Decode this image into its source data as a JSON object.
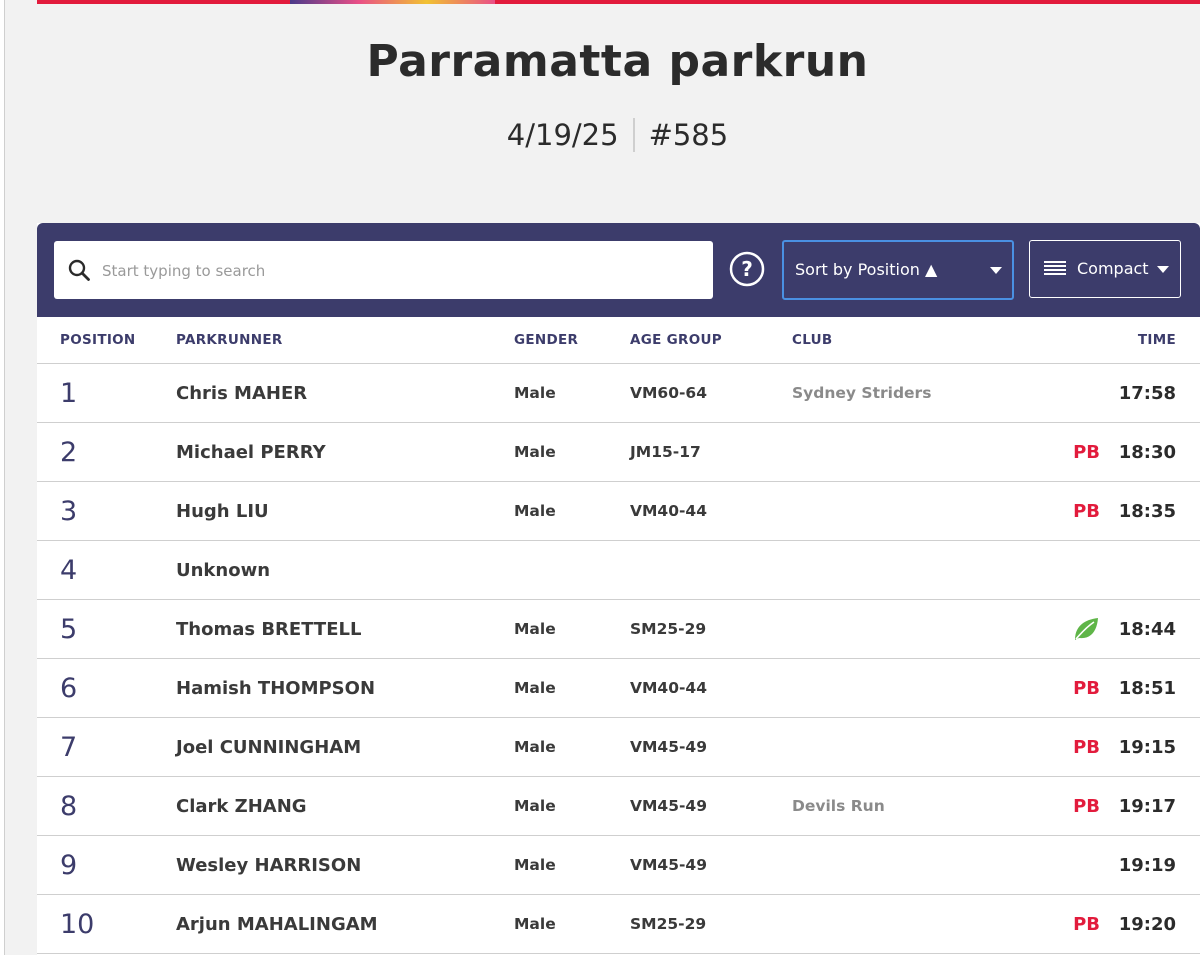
{
  "event": {
    "title": "Parramatta parkrun",
    "date": "4/19/25",
    "number": "#585"
  },
  "toolbar": {
    "search_placeholder": "Start typing to search",
    "help_label": "?",
    "sort_label": "Sort by Position ▲",
    "view_label": "Compact"
  },
  "table": {
    "headers": {
      "position": "POSITION",
      "parkrunner": "PARKRUNNER",
      "gender": "GENDER",
      "age_group": "AGE GROUP",
      "club": "CLUB",
      "time": "TIME"
    },
    "rows": [
      {
        "position": "1",
        "name": "Chris MAHER",
        "gender": "Male",
        "age_group": "VM60-64",
        "club": "Sydney Striders",
        "flag": "",
        "time": "17:58"
      },
      {
        "position": "2",
        "name": "Michael PERRY",
        "gender": "Male",
        "age_group": "JM15-17",
        "club": "",
        "flag": "PB",
        "time": "18:30"
      },
      {
        "position": "3",
        "name": "Hugh LIU",
        "gender": "Male",
        "age_group": "VM40-44",
        "club": "",
        "flag": "PB",
        "time": "18:35"
      },
      {
        "position": "4",
        "name": "Unknown",
        "gender": "",
        "age_group": "",
        "club": "",
        "flag": "",
        "time": ""
      },
      {
        "position": "5",
        "name": "Thomas BRETTELL",
        "gender": "Male",
        "age_group": "SM25-29",
        "club": "",
        "flag": "leaf-icon",
        "time": "18:44"
      },
      {
        "position": "6",
        "name": "Hamish THOMPSON",
        "gender": "Male",
        "age_group": "VM40-44",
        "club": "",
        "flag": "PB",
        "time": "18:51"
      },
      {
        "position": "7",
        "name": "Joel CUNNINGHAM",
        "gender": "Male",
        "age_group": "VM45-49",
        "club": "",
        "flag": "PB",
        "time": "19:15"
      },
      {
        "position": "8",
        "name": "Clark ZHANG",
        "gender": "Male",
        "age_group": "VM45-49",
        "club": "Devils Run",
        "flag": "PB",
        "time": "19:17"
      },
      {
        "position": "9",
        "name": "Wesley HARRISON",
        "gender": "Male",
        "age_group": "VM45-49",
        "club": "",
        "flag": "",
        "time": "19:19"
      },
      {
        "position": "10",
        "name": "Arjun MAHALINGAM",
        "gender": "Male",
        "age_group": "SM25-29",
        "club": "",
        "flag": "PB",
        "time": "19:20"
      }
    ]
  },
  "colors": {
    "brand_red": "#e21b3c",
    "toolbar_bg": "#3c3c6b",
    "focus_blue": "#4a90e2",
    "leaf_green": "#5fb548"
  }
}
